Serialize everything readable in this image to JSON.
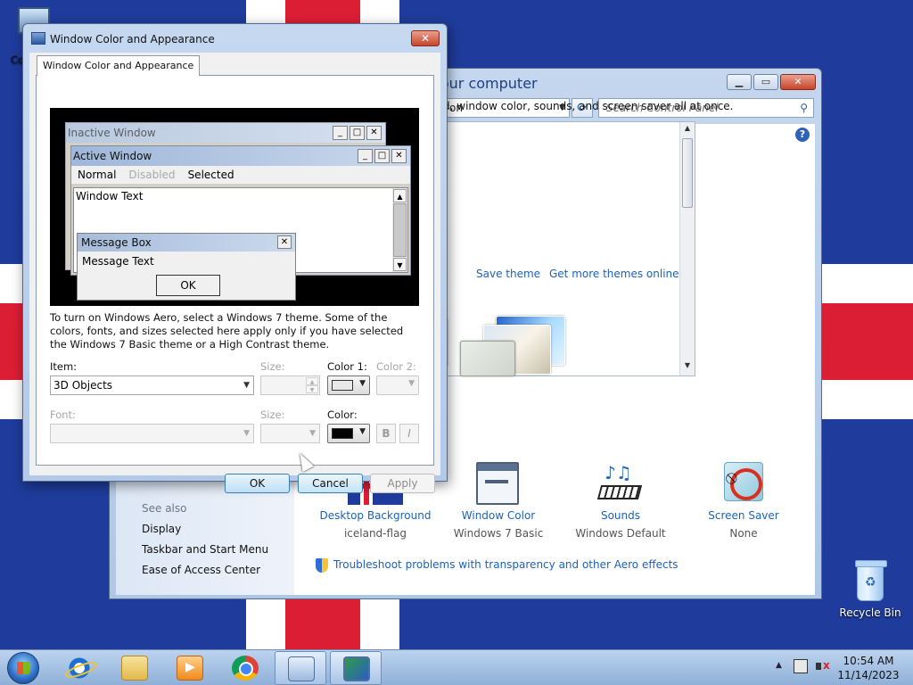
{
  "desktop": {
    "computer_label": "Co",
    "recycle_bin_label": "Recycle Bin"
  },
  "control_panel": {
    "address_text": "on",
    "search_placeholder": "Search Control Panel",
    "heading": "nd sounds on your computer",
    "subheading": "desktop background, window color, sounds, and screen saver all at once.",
    "save_theme": "Save theme",
    "get_more_themes": "Get more themes online",
    "bottom_items": [
      {
        "title": "Desktop Background",
        "sub": "iceland-flag",
        "icon": "flag-icon"
      },
      {
        "title": "Window Color",
        "sub": "Windows 7 Basic",
        "icon": "window-color-icon"
      },
      {
        "title": "Sounds",
        "sub": "Windows Default",
        "icon": "sounds-icon"
      },
      {
        "title": "Screen Saver",
        "sub": "None",
        "icon": "screen-saver-icon"
      }
    ],
    "troubleshoot_link": "Troubleshoot problems with transparency and other Aero effects",
    "see_also": "See also",
    "side_links": [
      "Display",
      "Taskbar and Start Menu",
      "Ease of Access Center"
    ]
  },
  "dialog": {
    "title": "Window Color and Appearance",
    "tab_label": "Window Color and Appearance",
    "preview": {
      "inactive_title": "Inactive Window",
      "active_title": "Active Window",
      "menu_normal": "Normal",
      "menu_disabled": "Disabled",
      "menu_selected": "Selected",
      "window_text": "Window Text",
      "msgbox_title": "Message Box",
      "msgbox_text": "Message Text",
      "msgbox_ok": "OK"
    },
    "help_text": "To turn on Windows Aero, select a Windows 7 theme.  Some of the colors, fonts, and sizes selected here apply only if you have selected the Windows 7 Basic theme or a High Contrast theme.",
    "item_label": "Item:",
    "item_value": "3D Objects",
    "size_label": "Size:",
    "color1_label": "Color 1:",
    "color2_label": "Color 2:",
    "font_label": "Font:",
    "font_size_label": "Size:",
    "font_color_label": "Color:",
    "bold_label": "B",
    "italic_label": "I",
    "ok_label": "OK",
    "cancel_label": "Cancel",
    "apply_label": "Apply",
    "color1_value": "#e8e8e8",
    "font_color_value": "#000000"
  },
  "taskbar": {
    "time": "10:54 AM",
    "date": "11/14/2023"
  }
}
